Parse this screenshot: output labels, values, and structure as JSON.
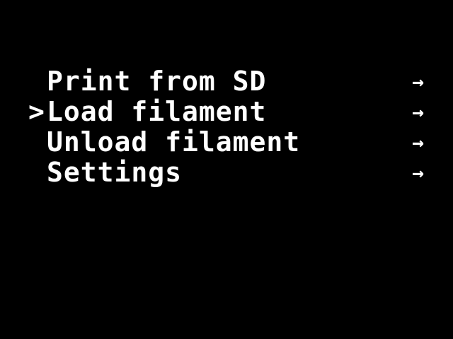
{
  "colors": {
    "background": "#000000",
    "foreground": "#ffffff"
  },
  "menu": {
    "selected_index": 1,
    "cursor_glyph": ">",
    "items": [
      {
        "label": "Print from SD",
        "arrow": "→",
        "selected": false
      },
      {
        "label": "Load filament",
        "arrow": "→",
        "selected": true
      },
      {
        "label": "Unload filament",
        "arrow": "→",
        "selected": false
      },
      {
        "label": "Settings",
        "arrow": "→",
        "selected": false
      }
    ]
  }
}
